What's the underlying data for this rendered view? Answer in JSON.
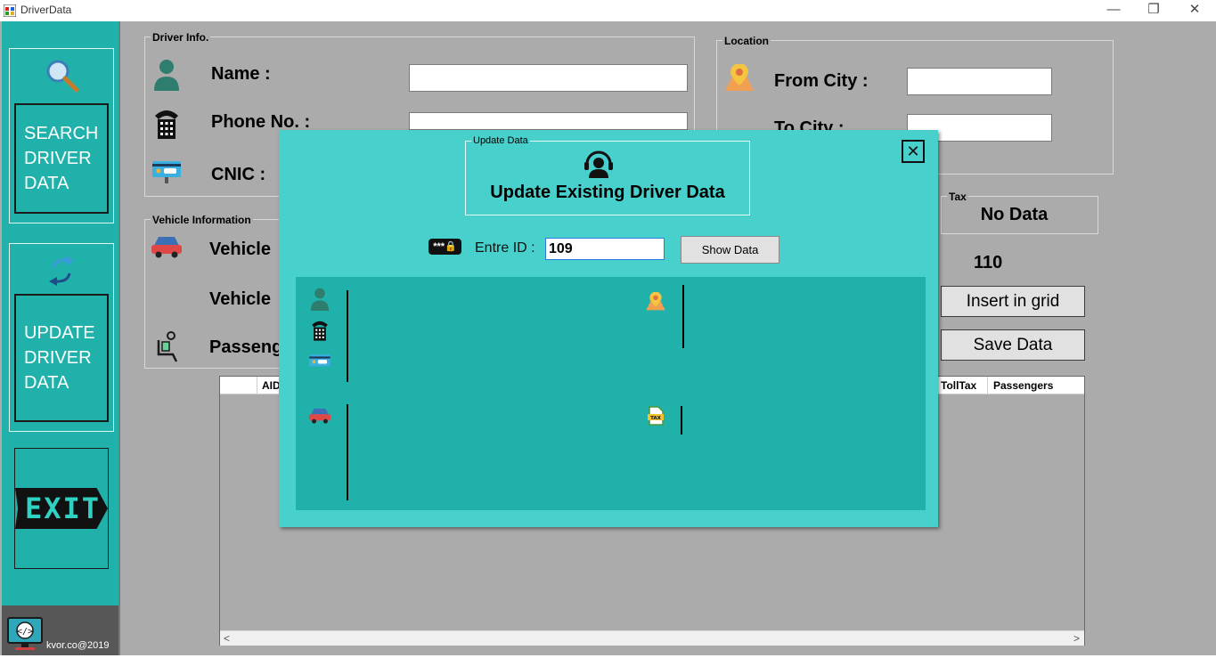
{
  "window": {
    "title": "DriverData",
    "minimize_glyph": "—",
    "restore_glyph": "❐",
    "close_glyph": "✕"
  },
  "sidebar": {
    "search_button": "SEARCH DRIVER DATA",
    "search_icon": "magnifier-icon",
    "update_button": "UPDATE DRIVER DATA",
    "update_icon": "refresh-arrows-icon",
    "exit_button": "EXIT",
    "footer_text": "kvor.co@2019",
    "footer_icon": "code-monitor-icon"
  },
  "driver_info": {
    "group_label": "Driver Info.",
    "name_label": "Name :",
    "phone_label": "Phone No. :",
    "cnic_label": "CNIC :",
    "name_value": "",
    "phone_value": ""
  },
  "location": {
    "group_label": "Location",
    "from_label": "From City :",
    "to_label": "To City :",
    "from_value": "",
    "to_value": ""
  },
  "vehicle_info": {
    "group_label": "Vehicle Information",
    "vehicle_label_1": "Vehicle",
    "vehicle_label_2": "Vehicle",
    "passengers_label": "Passeng"
  },
  "tax": {
    "group_label": "Tax",
    "value": "No Data"
  },
  "right_panel": {
    "count": "110",
    "insert_button": "Insert in grid",
    "save_button": "Save Data"
  },
  "grid": {
    "columns": [
      "AID",
      "TollTax",
      "Passengers"
    ],
    "scroll_left": "<",
    "scroll_right": ">"
  },
  "dialog": {
    "group_label": "Update Data",
    "heading": "Update Existing Driver Data",
    "id_label": "Entre ID :",
    "id_value": "109",
    "show_button": "Show Data",
    "close_glyph": "✕",
    "password_icon_text": "***🔒"
  },
  "colors": {
    "teal": "#20b2aa",
    "dialog_teal": "#48d1cc",
    "background_gray": "#ababab"
  }
}
